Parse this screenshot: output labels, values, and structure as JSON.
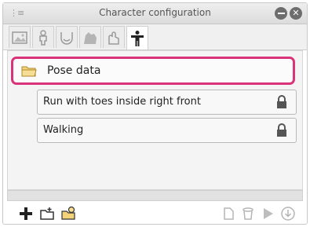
{
  "window": {
    "title": "Character configuration",
    "grip_icon": "drag-grip-icon",
    "minimize_icon": "minimize-icon",
    "close_icon": "close-icon"
  },
  "tabs": [
    {
      "name": "tab-image",
      "icon": "image-icon",
      "active": false
    },
    {
      "name": "tab-figure",
      "icon": "figure-icon",
      "active": false
    },
    {
      "name": "tab-face",
      "icon": "face-icon",
      "active": false
    },
    {
      "name": "tab-animal",
      "icon": "animal-icon",
      "active": false
    },
    {
      "name": "tab-hand",
      "icon": "hand-icon",
      "active": false
    },
    {
      "name": "tab-pose",
      "icon": "pose-figure-icon",
      "active": true
    }
  ],
  "list": {
    "folder": {
      "label": "Pose data",
      "icon": "folder-icon",
      "highlight_color": "#d9337a"
    },
    "items": [
      {
        "label": "Run with toes inside right front",
        "icon": "lock-icon"
      },
      {
        "label": "Walking",
        "icon": "lock-icon"
      }
    ]
  },
  "toolbar": {
    "left": [
      "add-icon",
      "new-folder-icon",
      "new-pose-icon"
    ],
    "right": [
      "page-icon",
      "trash-icon",
      "play-icon",
      "download-icon"
    ]
  },
  "colors": {
    "accent": "#d9337a",
    "titlebar": "#e2e2e2",
    "window_buttons": "#6d6d6d"
  }
}
